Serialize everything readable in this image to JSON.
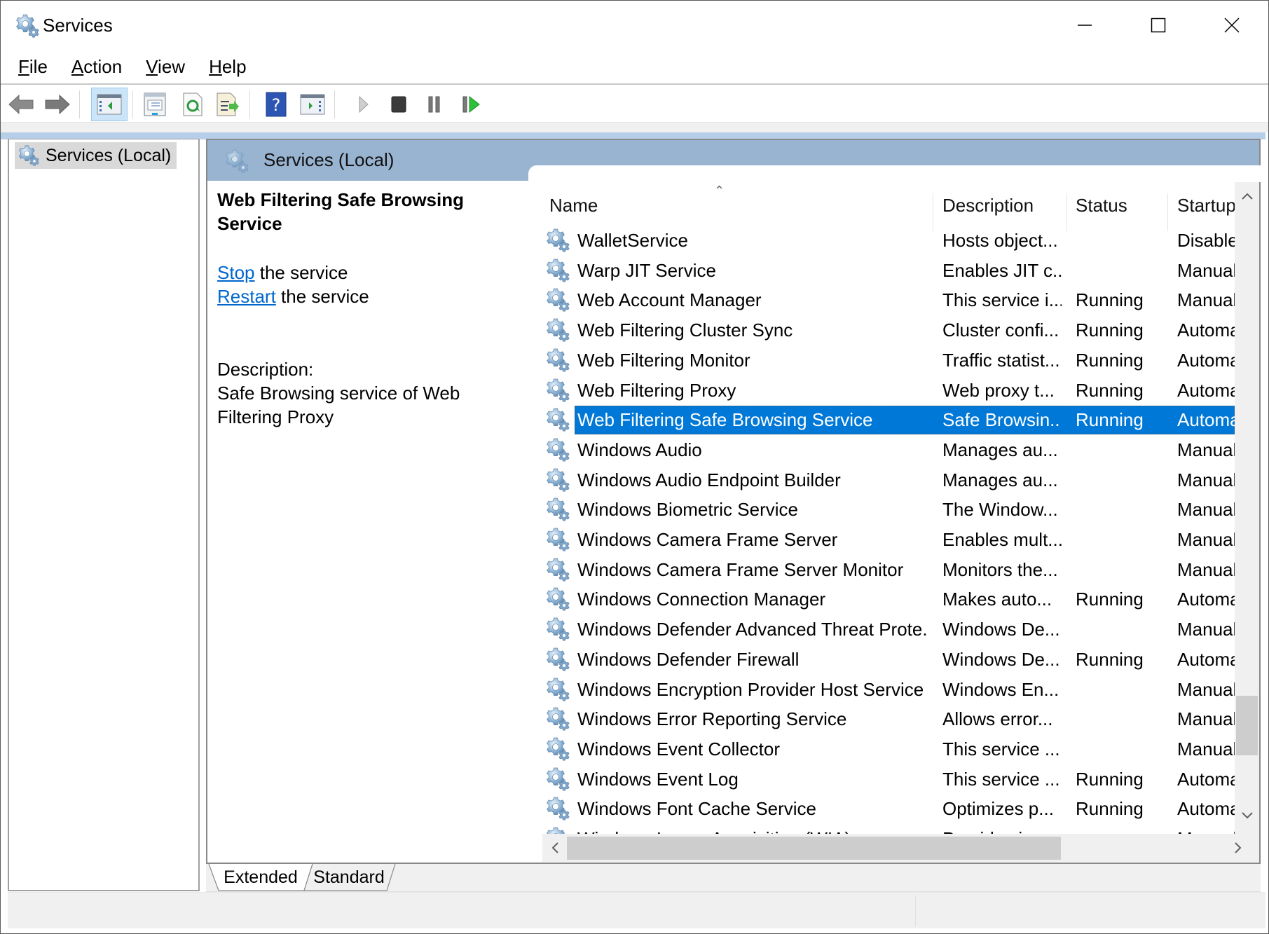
{
  "window": {
    "title": "Services",
    "icon": "services-gear-icon",
    "controls": {
      "minimize": "minimize-icon",
      "maximize": "maximize-icon",
      "close": "close-icon"
    }
  },
  "menu": [
    {
      "label": "File",
      "accel": "F",
      "rest": "ile"
    },
    {
      "label": "Action",
      "accel": "A",
      "rest": "ction"
    },
    {
      "label": "View",
      "accel": "V",
      "rest": "iew"
    },
    {
      "label": "Help",
      "accel": "H",
      "rest": "elp"
    }
  ],
  "toolbar": [
    {
      "name": "back-button",
      "icon": "arrow-left-icon"
    },
    {
      "name": "forward-button",
      "icon": "arrow-right-icon"
    },
    {
      "name": "show-hide-console-tree-button",
      "icon": "console-tree-icon",
      "active": true
    },
    {
      "name": "properties-button",
      "icon": "properties-icon"
    },
    {
      "name": "refresh-button",
      "icon": "refresh-icon"
    },
    {
      "name": "export-list-button",
      "icon": "export-list-icon"
    },
    {
      "name": "help-button",
      "icon": "help-icon"
    },
    {
      "name": "show-hide-action-pane-button",
      "icon": "action-pane-icon"
    },
    {
      "name": "start-service-button",
      "icon": "play-icon"
    },
    {
      "name": "stop-service-button",
      "icon": "stop-icon"
    },
    {
      "name": "pause-service-button",
      "icon": "pause-icon"
    },
    {
      "name": "resume-service-button",
      "icon": "resume-icon"
    }
  ],
  "tree": {
    "label": "Services (Local)"
  },
  "pane": {
    "header": "Services (Local)",
    "selected_service": "Web Filtering Safe Browsing Service",
    "stop_link": "Stop",
    "stop_suffix": " the service",
    "restart_link": "Restart",
    "restart_suffix": " the service",
    "description_label": "Description:",
    "description_text": "Safe Browsing service of Web Filtering Proxy"
  },
  "columns": {
    "name": "Name",
    "description": "Description",
    "status": "Status",
    "startup": "Startup"
  },
  "colors": {
    "selection": "#0078d7",
    "header_band": "#99b4d1",
    "link": "#0066cc"
  },
  "services": [
    {
      "name": "WalletService",
      "description": "Hosts object...",
      "status": "",
      "startup": "Disable"
    },
    {
      "name": "Warp JIT Service",
      "description": "Enables JIT c...",
      "status": "",
      "startup": "Manual"
    },
    {
      "name": "Web Account Manager",
      "description": "This service i...",
      "status": "Running",
      "startup": "Manual"
    },
    {
      "name": "Web Filtering Cluster Sync",
      "description": "Cluster confi...",
      "status": "Running",
      "startup": "Automa"
    },
    {
      "name": "Web Filtering Monitor",
      "description": "Traffic statist...",
      "status": "Running",
      "startup": "Automa"
    },
    {
      "name": "Web Filtering Proxy",
      "description": "Web proxy t...",
      "status": "Running",
      "startup": "Automa"
    },
    {
      "name": "Web Filtering Safe Browsing Service",
      "description": "Safe Browsin...",
      "status": "Running",
      "startup": "Automa",
      "selected": true
    },
    {
      "name": "Windows Audio",
      "description": "Manages au...",
      "status": "",
      "startup": "Manual"
    },
    {
      "name": "Windows Audio Endpoint Builder",
      "description": "Manages au...",
      "status": "",
      "startup": "Manual"
    },
    {
      "name": "Windows Biometric Service",
      "description": "The Window...",
      "status": "",
      "startup": "Manual"
    },
    {
      "name": "Windows Camera Frame Server",
      "description": "Enables mult...",
      "status": "",
      "startup": "Manual"
    },
    {
      "name": "Windows Camera Frame Server Monitor",
      "description": "Monitors the...",
      "status": "",
      "startup": "Manual"
    },
    {
      "name": "Windows Connection Manager",
      "description": "Makes auto...",
      "status": "Running",
      "startup": "Automa"
    },
    {
      "name": "Windows Defender Advanced Threat Prote...",
      "description": "Windows De...",
      "status": "",
      "startup": "Manual"
    },
    {
      "name": "Windows Defender Firewall",
      "description": "Windows De...",
      "status": "Running",
      "startup": "Automa"
    },
    {
      "name": "Windows Encryption Provider Host Service",
      "description": "Windows En...",
      "status": "",
      "startup": "Manual"
    },
    {
      "name": "Windows Error Reporting Service",
      "description": "Allows error...",
      "status": "",
      "startup": "Manual"
    },
    {
      "name": "Windows Event Collector",
      "description": "This service ...",
      "status": "",
      "startup": "Manual"
    },
    {
      "name": "Windows Event Log",
      "description": "This service ...",
      "status": "Running",
      "startup": "Automa"
    },
    {
      "name": "Windows Font Cache Service",
      "description": "Optimizes p...",
      "status": "Running",
      "startup": "Automa"
    },
    {
      "name": "Windows Image Acquisition (WIA)",
      "description": "Provides ima...",
      "status": "",
      "startup": "Manual"
    }
  ],
  "tabs": [
    {
      "label": "Extended",
      "active": true
    },
    {
      "label": "Standard",
      "active": false
    }
  ]
}
